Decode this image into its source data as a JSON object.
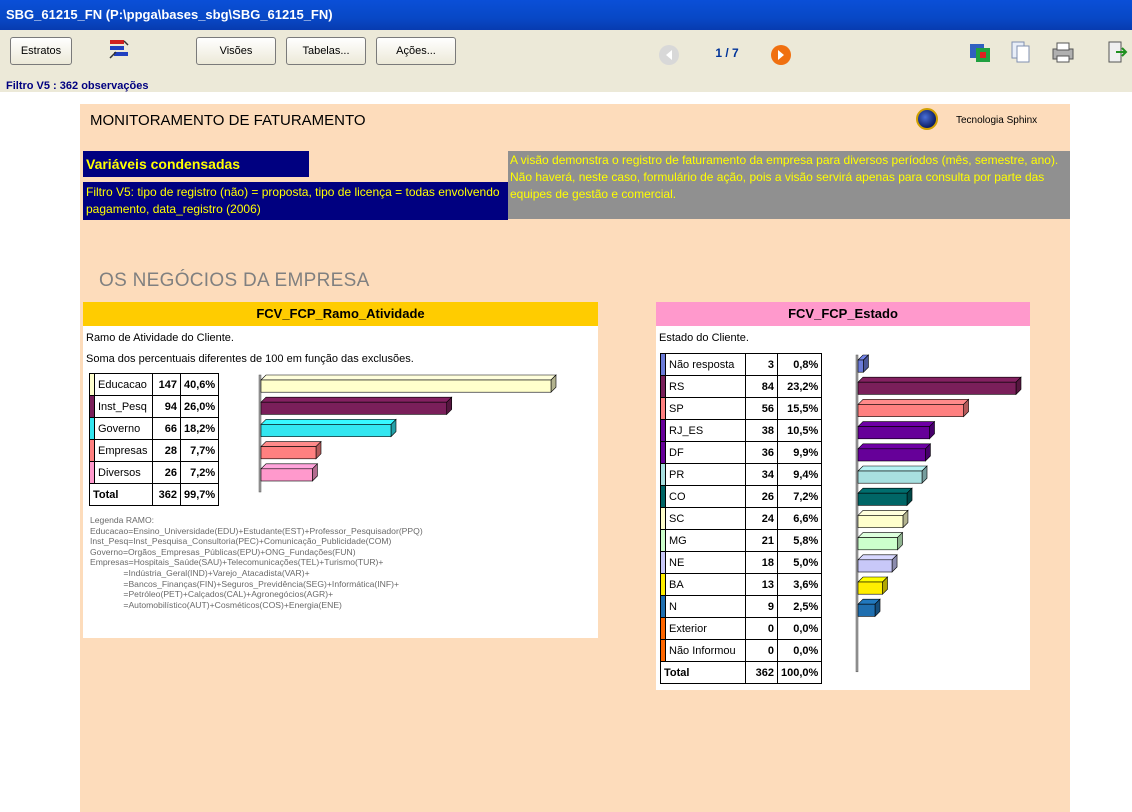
{
  "window": {
    "title": "SBG_61215_FN (P:\\ppga\\bases_sbg\\SBG_61215_FN)"
  },
  "toolbar": {
    "estratos_label": "Estratos",
    "visoes_label": "Visões",
    "tabelas_label": "Tabelas...",
    "acoes_label": "Ações...",
    "page_indicator": "1 / 7",
    "filter_status": "Filtro V5 : 362 observações",
    "icons": [
      "strata-icon",
      "back-arrow-icon",
      "forward-arrow-icon",
      "export-icon",
      "copy-icon",
      "print-icon",
      "exit-icon"
    ]
  },
  "report": {
    "title": "MONITORAMENTO DE FATURAMENTO",
    "brand": "Tecnologia Sphinx",
    "condensed_label": "Variáveis condensadas",
    "filter_text": "Filtro V5: tipo de registro (não) = proposta, tipo de licença = todas envolvendo pagamento, data_registro (2006)",
    "description": "A visão demonstra o registro de faturamento da empresa para diversos períodos (mês, semestre, ano).\nNão haverá, neste caso, formulário de ação, pois a visão servirá apenas para consulta por parte das equipes de gestão e comercial.",
    "section_title": "OS NEGÓCIOS DA EMPRESA",
    "colors": {
      "canvas": "#fddcbb",
      "header_ramo": "#ffcc00",
      "header_estado": "#ff99cc",
      "condensed_bg": "#000080",
      "condensed_fg": "#ffff00",
      "desc_bg": "#909090"
    }
  },
  "ramo": {
    "header": "FCV_FCP_Ramo_Atividade",
    "subtitle": "Ramo de Atividade do Cliente.",
    "note": "Soma dos percentuais diferentes de 100 em função das exclusões.",
    "rows": [
      {
        "label": "Educacao",
        "count": "147",
        "pct": "40,6%",
        "value": 40.6,
        "color": "#ffffcc"
      },
      {
        "label": "Inst_Pesq",
        "count": "94",
        "pct": "26,0%",
        "value": 26.0,
        "color": "#7a1f5a"
      },
      {
        "label": "Governo",
        "count": "66",
        "pct": "18,2%",
        "value": 18.2,
        "color": "#33e6f0"
      },
      {
        "label": "Empresas",
        "count": "28",
        "pct": "7,7%",
        "value": 7.7,
        "color": "#ff8080"
      },
      {
        "label": "Diversos",
        "count": "26",
        "pct": "7,2%",
        "value": 7.2,
        "color": "#ff99cc"
      }
    ],
    "total": {
      "label": "Total",
      "count": "362",
      "pct": "99,7%"
    },
    "legend": "Legenda RAMO:\nEducacao=Ensino_Universidade(EDU)+Estudante(EST)+Professor_Pesquisador(PPQ)\nInst_Pesq=Inst_Pesquisa_Consultoria(PEC)+Comunicação_Publicidade(COM)\nGoverno=Orgãos_Empresas_Públicas(EPU)+ONG_Fundações(FUN)\nEmpresas=Hospitais_Saúde(SAU)+Telecomunicações(TEL)+Turismo(TUR)+\n              =Indústria_Geral(IND)+Varejo_Atacadista(VAR)+\n              =Bancos_Finanças(FIN)+Seguros_Previdência(SEG)+Informática(INF)+\n              =Petróleo(PET)+Calçados(CAL)+Agronegócios(AGR)+\n              =Automobilístico(AUT)+Cosméticos(COS)+Energia(ENE)"
  },
  "estado": {
    "header": "FCV_FCP_Estado",
    "subtitle": "Estado do Cliente.",
    "rows": [
      {
        "label": "Não resposta",
        "count": "3",
        "pct": "0,8%",
        "value": 0.8,
        "color": "#6b7bd8"
      },
      {
        "label": "RS",
        "count": "84",
        "pct": "23,2%",
        "value": 23.2,
        "color": "#7a1f5a"
      },
      {
        "label": "SP",
        "count": "56",
        "pct": "15,5%",
        "value": 15.5,
        "color": "#ff8080"
      },
      {
        "label": "RJ_ES",
        "count": "38",
        "pct": "10,5%",
        "value": 10.5,
        "color": "#660099"
      },
      {
        "label": "DF",
        "count": "36",
        "pct": "9,9%",
        "value": 9.9,
        "color": "#660099"
      },
      {
        "label": "PR",
        "count": "34",
        "pct": "9,4%",
        "value": 9.4,
        "color": "#a8e0e0"
      },
      {
        "label": "CO",
        "count": "26",
        "pct": "7,2%",
        "value": 7.2,
        "color": "#006666"
      },
      {
        "label": "SC",
        "count": "24",
        "pct": "6,6%",
        "value": 6.6,
        "color": "#ffffcc"
      },
      {
        "label": "MG",
        "count": "21",
        "pct": "5,8%",
        "value": 5.8,
        "color": "#ccffcc"
      },
      {
        "label": "NE",
        "count": "18",
        "pct": "5,0%",
        "value": 5.0,
        "color": "#c8c8f8"
      },
      {
        "label": "BA",
        "count": "13",
        "pct": "3,6%",
        "value": 3.6,
        "color": "#ffee00"
      },
      {
        "label": "N",
        "count": "9",
        "pct": "2,5%",
        "value": 2.5,
        "color": "#1f6fb0"
      },
      {
        "label": "Exterior",
        "count": "0",
        "pct": "0,0%",
        "value": 0.0,
        "color": "#ff6600"
      },
      {
        "label": "Não Informou",
        "count": "0",
        "pct": "0,0%",
        "value": 0.0,
        "color": "#ff6600"
      }
    ],
    "total": {
      "label": "Total",
      "count": "362",
      "pct": "100,0%"
    }
  }
}
